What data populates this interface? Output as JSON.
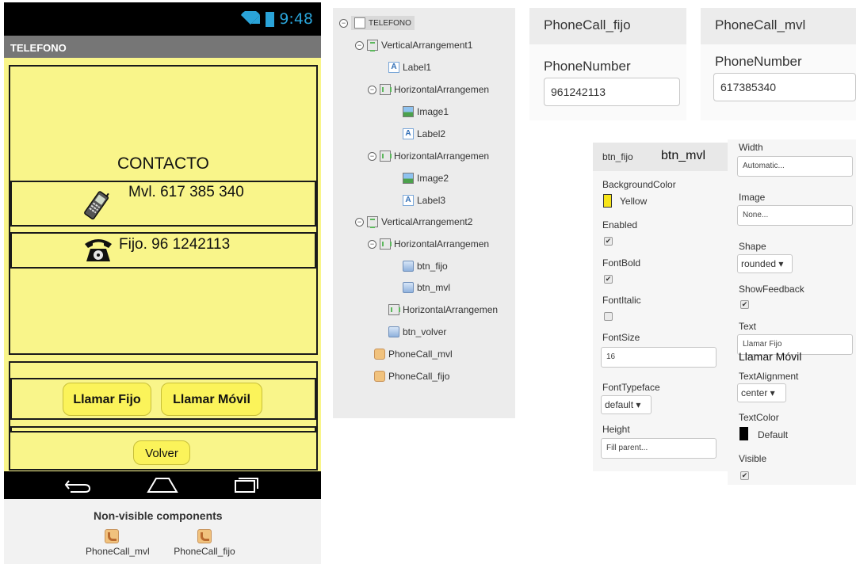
{
  "phone": {
    "status_time": "9:48",
    "screen_title": "TELEFONO",
    "heading": "CONTACTO",
    "mobile_text": "Mvl. 617 385 340",
    "landline_text": "Fijo. 96 1242113",
    "btn_fijo_label": "Llamar Fijo",
    "btn_movil_label": "Llamar Móvil",
    "btn_volver_label": "Volver",
    "nonvisible_title": "Non-visible components",
    "nonvisible_items": [
      "PhoneCall_mvl",
      "PhoneCall_fijo"
    ],
    "background_color": "#f9f58a",
    "button_color": "#fbf35a"
  },
  "tree": {
    "nodes": [
      "TELEFONO",
      "VerticalArrangement1",
      "Label1",
      "HorizontalArrangemen",
      "Image1",
      "Label2",
      "HorizontalArrangemen",
      "Image2",
      "Label3",
      "VerticalArrangement2",
      "HorizontalArrangemen",
      "btn_fijo",
      "btn_mvl",
      "HorizontalArrangemen",
      "btn_volver",
      "PhoneCall_mvl",
      "PhoneCall_fijo"
    ]
  },
  "phonecall_fijo": {
    "title": "PhoneCall_fijo",
    "prop_label": "PhoneNumber",
    "value": "961242113"
  },
  "phonecall_mvl": {
    "title": "PhoneCall_mvl",
    "prop_label": "PhoneNumber",
    "value": "617385340"
  },
  "properties": {
    "component_a": "btn_fijo",
    "component_b": "btn_mvl",
    "background_color_label": "BackgroundColor",
    "background_color_value": "Yellow",
    "enabled_label": "Enabled",
    "fontbold_label": "FontBold",
    "fontitalic_label": "FontItalic",
    "fontsize_label": "FontSize",
    "fontsize_value": "16",
    "fonttypeface_label": "FontTypeface",
    "fonttypeface_value": "default ▾",
    "height_label": "Height",
    "height_value": "Fill parent...",
    "width_label": "Width",
    "width_value": "Automatic...",
    "image_label": "Image",
    "image_value": "None...",
    "shape_label": "Shape",
    "shape_value": "rounded ▾",
    "showfeedback_label": "ShowFeedback",
    "text_label": "Text",
    "text_value": "Llamar Fijo",
    "text_value_b": "Llamar Móvil",
    "textalignment_label": "TextAlignment",
    "textalignment_value": "center ▾",
    "textcolor_label": "TextColor",
    "textcolor_value": "Default",
    "visible_label": "Visible",
    "checkmark": "✔",
    "swatch_yellow": "#f7e51a",
    "swatch_default": "#000000"
  }
}
